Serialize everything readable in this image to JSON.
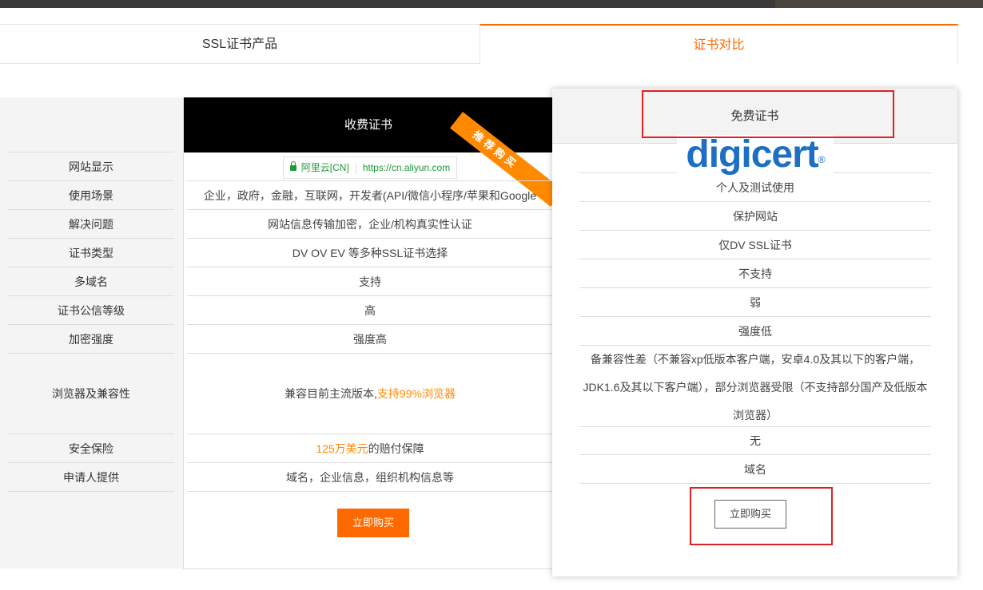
{
  "tabs": {
    "products": "SSL证书产品",
    "compare": "证书对比"
  },
  "labels": [
    "网站显示",
    "使用场景",
    "解决问题",
    "证书类型",
    "多域名",
    "证书公信等级",
    "加密强度",
    "浏览器及兼容性",
    "安全保险",
    "申请人提供"
  ],
  "paid": {
    "title": "收费证书",
    "ribbon": "推荐购买",
    "site_org": "阿里云[CN]",
    "site_url": "https://cn.aliyun.com",
    "scenario": "企业，政府，金融，互联网，开发者(API/微信小程序/苹果和Google",
    "problem": "网站信息传输加密，企业/机构真实性认证",
    "types": "DV OV EV 等多种SSL证书选择",
    "multidomain": "支持",
    "trust": "高",
    "strength": "强度高",
    "compat_prefix": "兼容目前主流版本,",
    "compat_highlight": "支持99%浏览器",
    "insurance_highlight": "125万美元",
    "insurance_suffix": "的赔付保障",
    "applicant": "域名，企业信息，组织机构信息等",
    "buy": "立即购买"
  },
  "free": {
    "title": "免费证书",
    "logo": "digicert",
    "scenario": "个人及测试使用",
    "problem": "保护网站",
    "types": "仅DV SSL证书",
    "multidomain": "不支持",
    "trust": "弱",
    "strength": "强度低",
    "compat": "备兼容性差（不兼容xp低版本客户端，安卓4.0及其以下的客户端，JDK1.6及其以下客户端），部分浏览器受限（不支持部分国产及低版本浏览器）",
    "insurance": "无",
    "applicant": "域名",
    "buy": "立即购买"
  },
  "colors": {
    "accent": "#ff6a00",
    "highlight": "#ff8a00",
    "secure": "#1e9a38",
    "annotation": "#e02020",
    "brand_digicert": "#1e6fc4"
  },
  "icons": [
    "lock-icon"
  ]
}
